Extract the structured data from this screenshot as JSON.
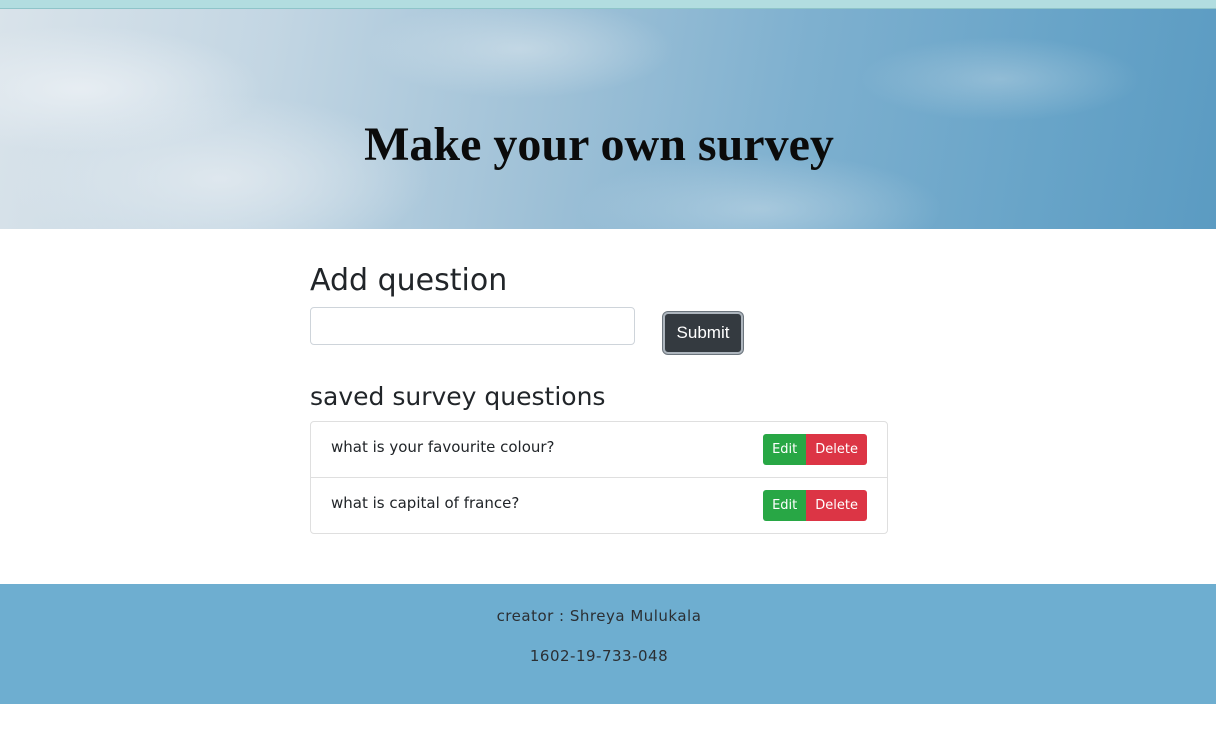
{
  "hero": {
    "title": "Make your own survey"
  },
  "add_question": {
    "heading": "Add question",
    "input_value": "",
    "input_placeholder": "",
    "submit_label": "Submit"
  },
  "saved": {
    "heading": "saved survey questions",
    "questions": [
      {
        "text": "what is your favourite colour?",
        "edit_label": "Edit",
        "delete_label": "Delete"
      },
      {
        "text": "what is capital of france?",
        "edit_label": "Edit",
        "delete_label": "Delete"
      }
    ]
  },
  "footer": {
    "creator": "creator : Shreya Mulukala",
    "id": "1602-19-733-048"
  },
  "colors": {
    "edit_button": "#28a745",
    "delete_button": "#dc3545",
    "submit_button": "#343a40",
    "footer_background": "#6eaed0"
  }
}
